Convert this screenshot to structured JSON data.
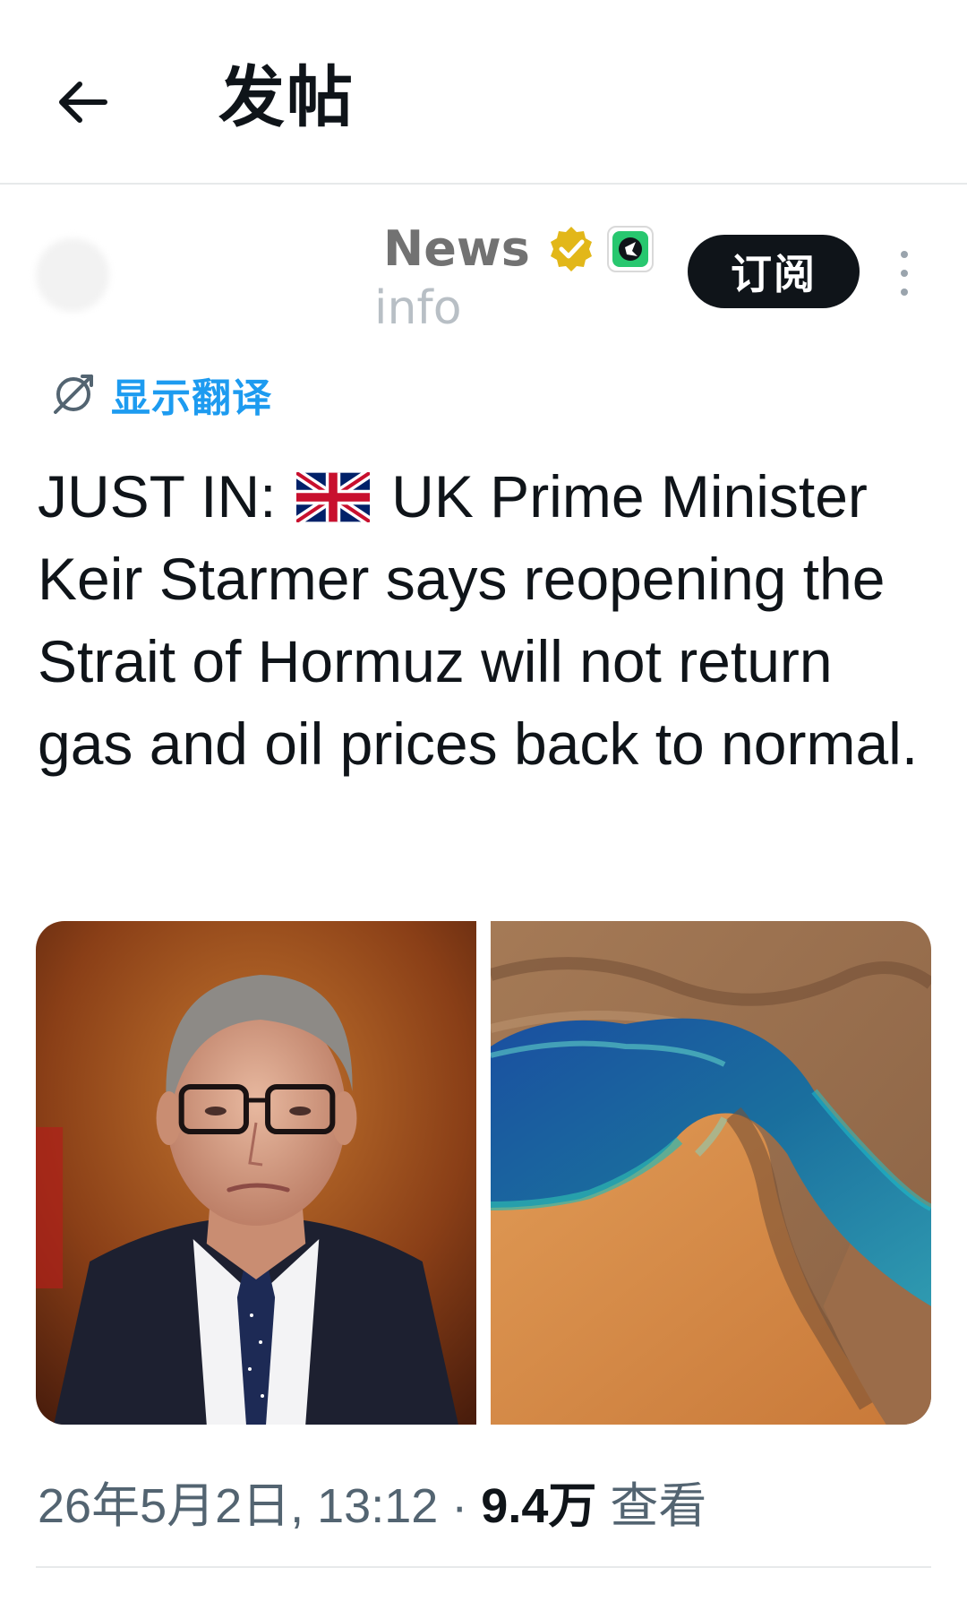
{
  "header": {
    "title": "发帖",
    "back_icon": "arrow-left-icon"
  },
  "author": {
    "name_visible": "News",
    "handle_visible": "info",
    "verified_icon": "verified-badge-icon",
    "affiliate_icon": "affiliate-badge-icon",
    "subscribe_label": "订阅",
    "more_icon": "more-vertical-icon"
  },
  "translate": {
    "icon": "translate-icon",
    "label": "显示翻译"
  },
  "tweet": {
    "text_before_flag": "JUST IN: ",
    "flag_icon": "uk-flag-icon",
    "text_after_flag": " UK Prime Minister Keir Starmer says reopening the Strait of Hormuz will not return gas and oil prices back to normal."
  },
  "media": [
    {
      "kind": "photo",
      "subject": "portrait"
    },
    {
      "kind": "photo",
      "subject": "satellite"
    }
  ],
  "meta": {
    "date_time": "26年5月2日, 13:12",
    "separator": " · ",
    "views_count": "9.4万",
    "views_label": " 查看"
  },
  "colors": {
    "text": "#0f1419",
    "muted": "#536471",
    "link": "#1d9bf0",
    "verified": "#e2b719",
    "divider": "#e7e9ea"
  }
}
